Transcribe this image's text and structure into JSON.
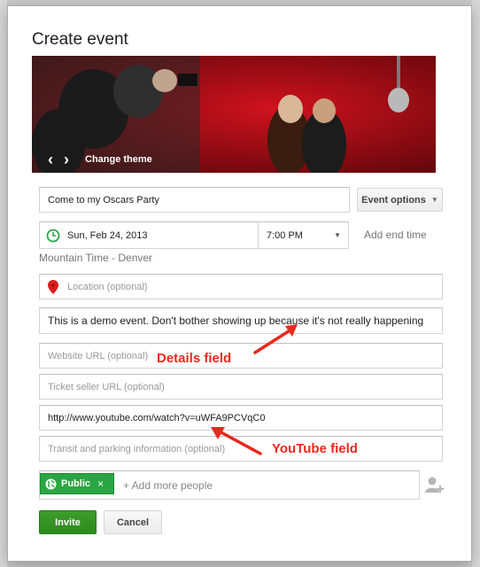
{
  "dialog": {
    "title": "Create event"
  },
  "banner": {
    "change_theme_label": "Change theme",
    "prev_glyph": "‹",
    "next_glyph": "›"
  },
  "event_title": {
    "value": "Come to my Oscars Party"
  },
  "event_options": {
    "label": "Event options"
  },
  "date": {
    "value": "Sun, Feb 24, 2013"
  },
  "time": {
    "value": "7:00 PM"
  },
  "add_end_time": "Add end time",
  "timezone": "Mountain Time - Denver",
  "location": {
    "placeholder": "Location (optional)"
  },
  "details": {
    "value": "This is a demo event. Don't bother showing up because it's not really happening"
  },
  "website": {
    "placeholder": "Website URL (optional)"
  },
  "ticket": {
    "placeholder": "Ticket seller URL (optional)"
  },
  "youtube": {
    "value": "http://www.youtube.com/watch?v=uWFA9PCVqC0"
  },
  "transit": {
    "placeholder": "Transit and parking information (optional)"
  },
  "annotations": {
    "details_label": "Details field",
    "youtube_label": "YouTube field"
  },
  "guests": {
    "chip_label": "Public",
    "chip_remove": "×",
    "add_more": "+ Add more people"
  },
  "actions": {
    "invite": "Invite",
    "cancel": "Cancel"
  },
  "colors": {
    "accent_green": "#2ba544",
    "annotation_red": "#e8291c",
    "banner_red": "#8a0c12"
  },
  "icons": [
    "calendar-clock-icon",
    "map-pin-icon",
    "globe-icon",
    "add-person-icon",
    "chevron-down-icon"
  ]
}
